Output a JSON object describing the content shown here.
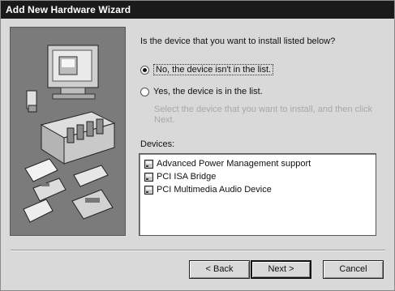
{
  "window": {
    "title": "Add New Hardware Wizard"
  },
  "prompt": "Is the device that you want to install listed below?",
  "options": [
    {
      "label": "No, the device isn't in the list.",
      "selected": true
    },
    {
      "label": "Yes, the device is in the list.",
      "selected": false
    }
  ],
  "hint": "Select the device that you want to install, and then click Next.",
  "devices": {
    "label": "Devices:",
    "items": [
      {
        "label": "Advanced Power Management support",
        "icon": "device-icon"
      },
      {
        "label": "PCI ISA Bridge",
        "icon": "device-icon"
      },
      {
        "label": "PCI Multimedia Audio Device",
        "icon": "device-icon"
      }
    ]
  },
  "buttons": {
    "back": "< Back",
    "next": "Next >",
    "cancel": "Cancel"
  },
  "colors": {
    "title_bar": "#1a1a1a",
    "dialog": "#d9d9d9",
    "artwork_bg": "#7b7b7b"
  }
}
